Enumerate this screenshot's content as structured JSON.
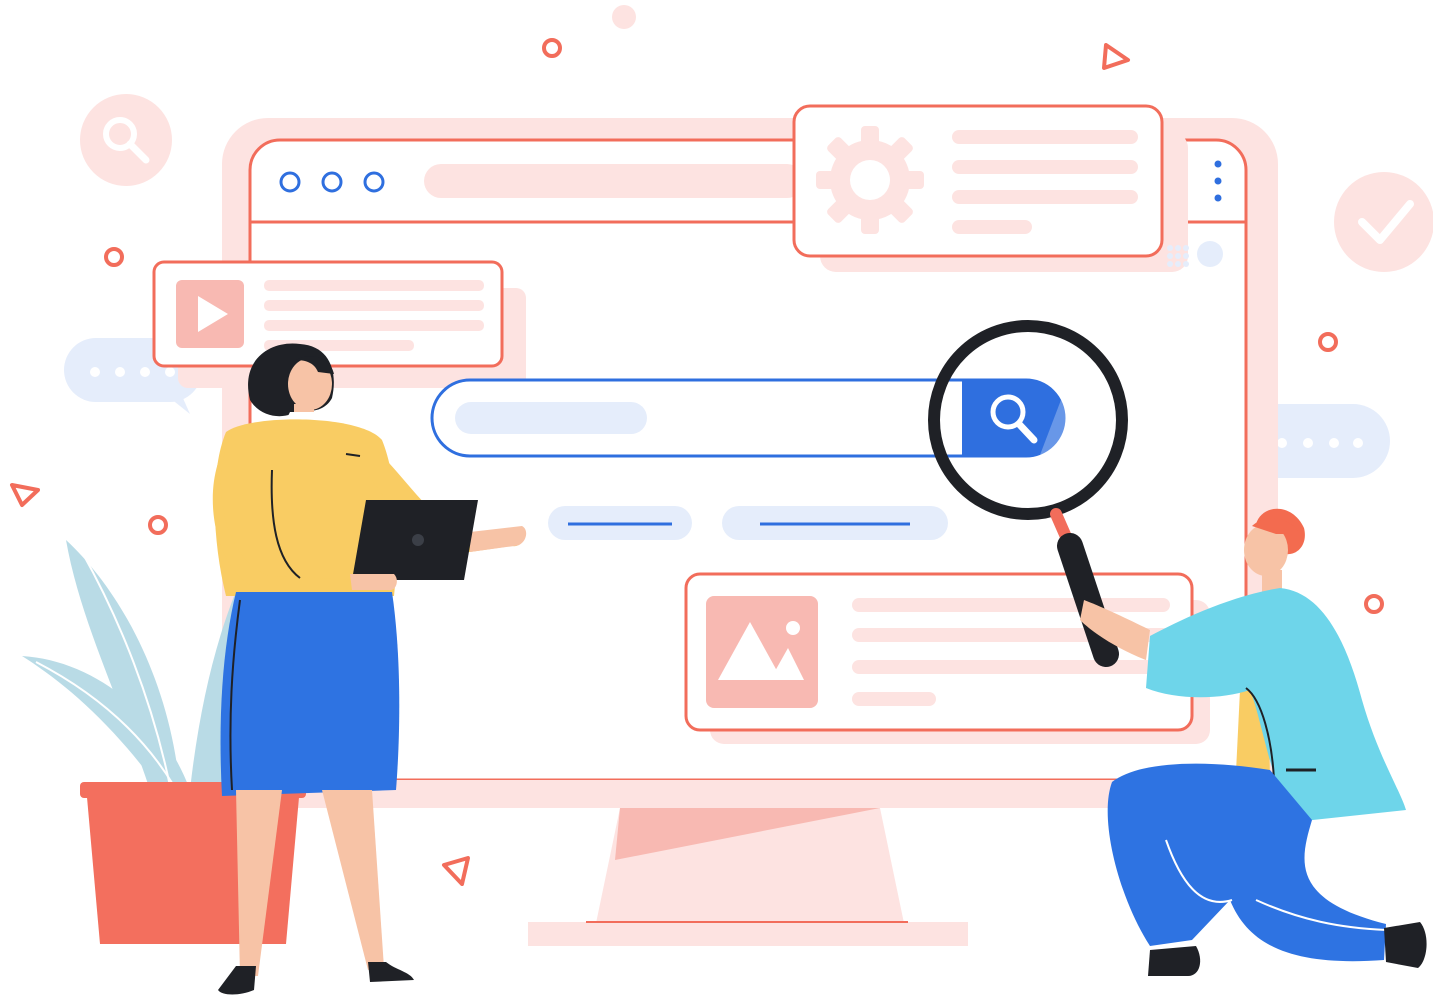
{
  "colors": {
    "accent_red": "#f26d5b",
    "soft_pink": "#fde3e1",
    "pink_line": "#f8b9b2",
    "brand_blue": "#2f6fdf",
    "light_blue": "#e5edfb",
    "dark_ink": "#1f2126",
    "skin": "#f7c3a6",
    "shirt_yellow": "#f9cc63",
    "skirt_blue": "#2e73e2",
    "jacket_cyan": "#6ed5ea",
    "hair_orange": "#f36b4f",
    "plant_leaf": "#b9dbe6",
    "pot_red": "#f36f5e"
  },
  "icons": {
    "window_dots": [
      "window-control-icon",
      "window-control-icon",
      "window-control-icon"
    ],
    "menu": "vertical-dots-menu-icon",
    "search": "magnifier-icon",
    "settings": "gear-icon",
    "video": "play-icon",
    "image": "mountain-image-icon",
    "camera": "video-camera-icon",
    "check": "checkmark-icon",
    "chat": "speech-bubble-icon"
  },
  "search": {
    "placeholder": "",
    "value": ""
  }
}
